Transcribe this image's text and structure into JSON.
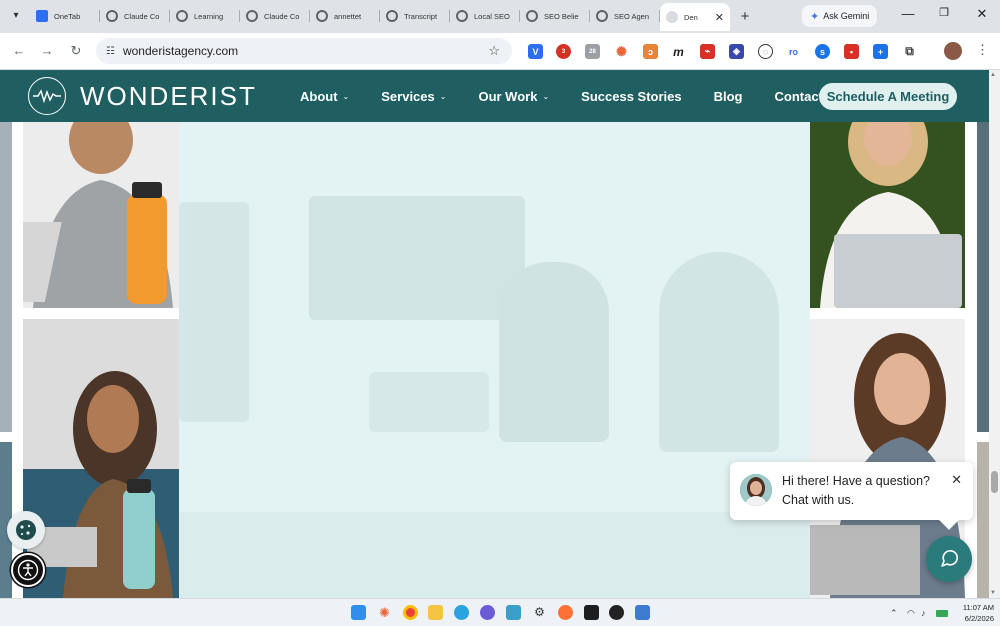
{
  "browser": {
    "tabs": [
      {
        "label": "OneTab",
        "favicon_color": "#2d6ef0"
      },
      {
        "label": "Claude Co",
        "favicon_color": "#5f6368"
      },
      {
        "label": "Learning",
        "favicon_color": "#5f6368"
      },
      {
        "label": "Claude Co",
        "favicon_color": "#5f6368"
      },
      {
        "label": "annettet",
        "favicon_color": "#5f6368"
      },
      {
        "label": "Transcript",
        "favicon_color": "#5f6368"
      },
      {
        "label": "Local SEO",
        "favicon_color": "#5f6368"
      },
      {
        "label": "SEO Belie",
        "favicon_color": "#5f6368"
      },
      {
        "label": "SEO Agen",
        "favicon_color": "#5f6368"
      },
      {
        "label": "Den",
        "favicon_color": "#d9dde2",
        "active": true
      }
    ],
    "gemini_label": "Ask Gemini",
    "url": "wonderistagency.com",
    "extension_badges": {
      "badge_1": "3",
      "badge_2": "28"
    }
  },
  "site": {
    "brand": "WONDERIST",
    "nav": [
      {
        "label": "About",
        "dropdown": true
      },
      {
        "label": "Services",
        "dropdown": true
      },
      {
        "label": "Our Work",
        "dropdown": true
      },
      {
        "label": "Success Stories",
        "dropdown": false
      },
      {
        "label": "Blog",
        "dropdown": false
      },
      {
        "label": "Contact",
        "dropdown": false
      }
    ],
    "cta_label": "Schedule A Meeting",
    "colors": {
      "nav_bg": "#1f5e61",
      "hero_tint": "#e3f2f2",
      "cta_bg": "#dff0ee",
      "chat_teal": "#2c7b7c"
    }
  },
  "chat": {
    "line1": "Hi there! Have a question?",
    "line2": "Chat with us."
  },
  "taskbar": {
    "time": "11:07 AM",
    "date": "6/2/2026"
  }
}
